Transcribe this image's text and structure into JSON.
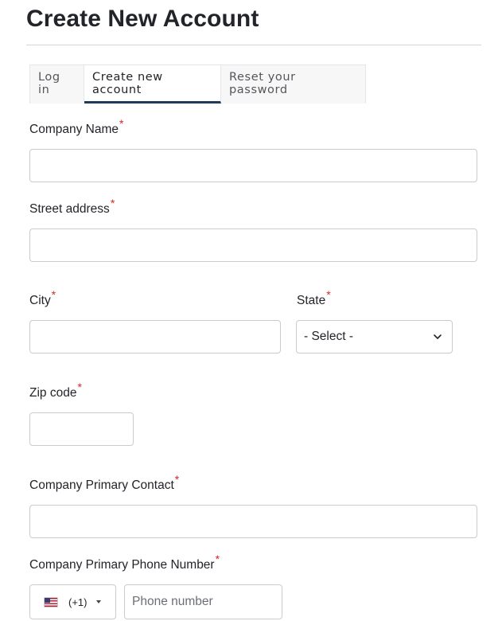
{
  "page": {
    "title": "Create New Account"
  },
  "tabs": [
    {
      "label": "Log in",
      "active": false
    },
    {
      "label": "Create new account",
      "active": true
    },
    {
      "label": "Reset your password",
      "active": false
    }
  ],
  "form": {
    "required_marker": "*",
    "company_name": {
      "label": "Company Name",
      "value": ""
    },
    "street_address": {
      "label": "Street address",
      "value": ""
    },
    "city": {
      "label": "City",
      "value": ""
    },
    "state": {
      "label": "State",
      "selected": "- Select -"
    },
    "zip_code": {
      "label": "Zip code",
      "value": ""
    },
    "primary_contact": {
      "label": "Company Primary Contact",
      "value": ""
    },
    "primary_phone": {
      "label": "Company Primary Phone Number",
      "country_flag": "us-flag-icon",
      "dial_code": "(+1)",
      "placeholder": "Phone number",
      "value": ""
    }
  },
  "colors": {
    "required": "#dc2626",
    "active_tab_underline": "#1f3b5a",
    "border": "#c9cbd1"
  }
}
